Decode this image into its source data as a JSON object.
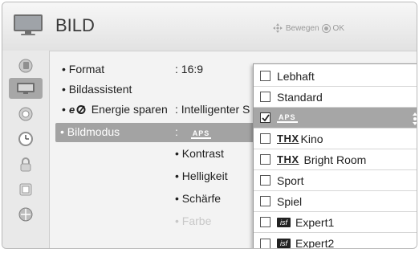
{
  "header": {
    "title": "BILD",
    "hint_move": "Bewegen",
    "hint_ok": "OK"
  },
  "sidebar": {
    "icons": [
      {
        "name": "input-icon"
      },
      {
        "name": "picture-icon",
        "selected": true
      },
      {
        "name": "audio-icon"
      },
      {
        "name": "time-icon"
      },
      {
        "name": "lock-icon"
      },
      {
        "name": "options-icon"
      },
      {
        "name": "network-icon"
      }
    ]
  },
  "menu": {
    "items": [
      {
        "label": "• Format",
        "value": ": 16:9"
      },
      {
        "label": "• Bildassistent",
        "value": ""
      },
      {
        "label": "• ",
        "logo": "eco",
        "label_rest": "Energie sparen",
        "value": ": Intelligenter S"
      },
      {
        "label": "• Bildmodus",
        "value": ":",
        "active": true
      }
    ],
    "sub_items": [
      {
        "label": "• Kontrast",
        "dim": false
      },
      {
        "label": "• Helligkeit",
        "dim": false
      },
      {
        "label": "• Schärfe",
        "dim": false
      },
      {
        "label": "• Farbe",
        "dim": true
      }
    ]
  },
  "popup": {
    "options": [
      {
        "label": "Lebhaft",
        "checked": false
      },
      {
        "label": "Standard",
        "checked": false
      },
      {
        "label": "",
        "logo": "APS",
        "checked": true
      },
      {
        "label": "Kino",
        "logo": "THX",
        "checked": false
      },
      {
        "label": "Bright Room",
        "logo": "THX",
        "checked": false
      },
      {
        "label": "Sport",
        "checked": false
      },
      {
        "label": "Spiel",
        "checked": false
      },
      {
        "label": "Expert1",
        "logo": "isf",
        "checked": false
      },
      {
        "label": "Expert2",
        "logo": "isf",
        "checked": false
      }
    ],
    "logo_text": {
      "aps": "APS",
      "thx": "THX",
      "isf": "isf"
    }
  },
  "colors": {
    "selection": "#a6a6a6",
    "background": "#f3f3f3",
    "text": "#1f1f1f"
  }
}
